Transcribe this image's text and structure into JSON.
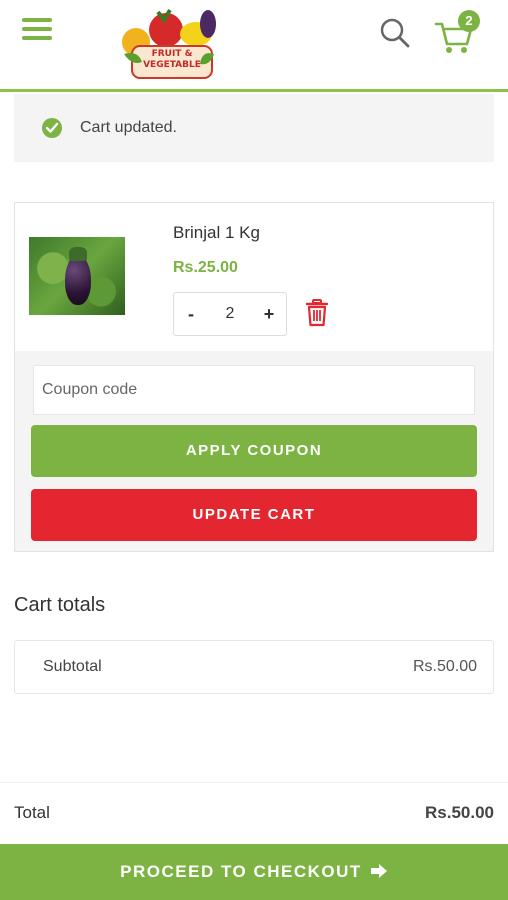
{
  "header": {
    "menu_icon": "hamburger-menu-icon",
    "logo_text_line1": "FRUIT &",
    "logo_text_line2": "VEGETABLE",
    "search_icon": "search-icon",
    "cart_icon": "cart-icon",
    "cart_count": "2"
  },
  "notice": {
    "icon": "check-circle-icon",
    "text": "Cart updated."
  },
  "cart_item": {
    "name": "Brinjal 1 Kg",
    "price": "Rs.25.00",
    "quantity": "2",
    "minus_label": "-",
    "plus_label": "+",
    "remove_icon": "trash-icon"
  },
  "coupon": {
    "placeholder": "Coupon code",
    "apply_label": "APPLY COUPON",
    "update_label": "UPDATE CART"
  },
  "totals": {
    "title": "Cart totals",
    "subtotal_label": "Subtotal",
    "subtotal_value": "Rs.50.00",
    "total_label": "Total",
    "total_value": "Rs.50.00"
  },
  "checkout": {
    "label": "PROCEED TO CHECKOUT",
    "arrow_icon": "arrow-right-icon"
  },
  "colors": {
    "accent_green": "#7cb342",
    "danger_red": "#e3262f"
  }
}
